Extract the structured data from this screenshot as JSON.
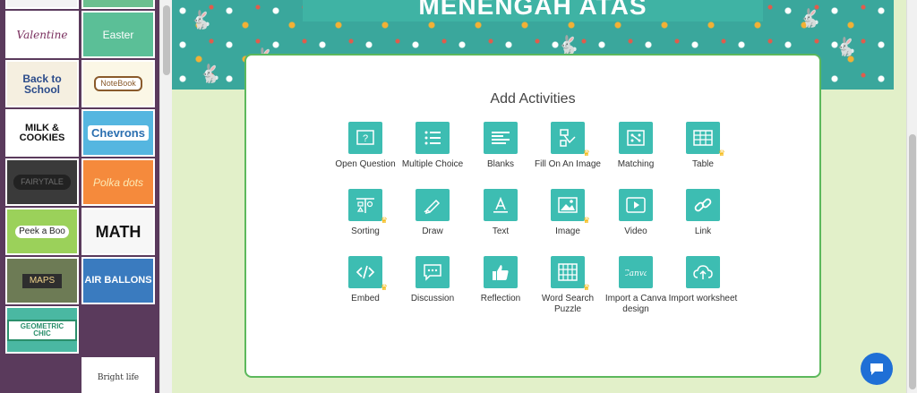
{
  "sidebar": {
    "themes": [
      {
        "label": "Valentine",
        "bg": "#ffffff",
        "color": "#7a2f5e"
      },
      {
        "label": "Easter",
        "bg": "#5bbf97",
        "color": "#ffffff"
      },
      {
        "label": "Back to School",
        "bg": "#f5efe0",
        "color": "#2b4b8a"
      },
      {
        "label": "NoteBook",
        "bg": "#fbf7e6",
        "color": "#8a5a2b"
      },
      {
        "label": "MILK & COOKIES",
        "bg": "#ffffff",
        "color": "#111111"
      },
      {
        "label": "Chevrons",
        "bg": "#55b6e0",
        "color": "#2a6fb0"
      },
      {
        "label": "FAIRYTALE",
        "bg": "#3a3a3a",
        "color": "#6f6f6f"
      },
      {
        "label": "Polka dots",
        "bg": "#f58a3c",
        "color": "#fce9b4"
      },
      {
        "label": "Peek a Boo",
        "bg": "#9bd15a",
        "color": "#222222"
      },
      {
        "label": "MATH",
        "bg": "#f7f7f7",
        "color": "#111111"
      },
      {
        "label": "MAPS",
        "bg": "#6d7b55",
        "color": "#f2d48b"
      },
      {
        "label": "AIR BALLONS",
        "bg": "#3a7bbf",
        "color": "#ffffff"
      },
      {
        "label": "GEOMETRIC CHIC",
        "bg": "#4ab8a2",
        "color": "#2a8f6b"
      },
      {
        "label": "Bright life",
        "bg": "#ffffff",
        "color": "#333333"
      }
    ]
  },
  "banner": {
    "title": "MENENGAH ATAS"
  },
  "card": {
    "title": "Add Activities",
    "activities": [
      {
        "label": "Open Question",
        "icon": "question-icon",
        "premium": false
      },
      {
        "label": "Multiple Choice",
        "icon": "list-icon",
        "premium": false
      },
      {
        "label": "Blanks",
        "icon": "blanks-icon",
        "premium": false
      },
      {
        "label": "Fill On An Image",
        "icon": "fill-image-icon",
        "premium": true
      },
      {
        "label": "Matching",
        "icon": "matching-icon",
        "premium": false
      },
      {
        "label": "Table",
        "icon": "table-icon",
        "premium": true
      },
      {
        "label": "Sorting",
        "icon": "sorting-icon",
        "premium": true
      },
      {
        "label": "Draw",
        "icon": "draw-icon",
        "premium": false
      },
      {
        "label": "Text",
        "icon": "text-icon",
        "premium": false
      },
      {
        "label": "Image",
        "icon": "image-icon",
        "premium": true
      },
      {
        "label": "Video",
        "icon": "video-icon",
        "premium": false
      },
      {
        "label": "Link",
        "icon": "link-icon",
        "premium": false
      },
      {
        "label": "Embed",
        "icon": "embed-icon",
        "premium": true
      },
      {
        "label": "Discussion",
        "icon": "discussion-icon",
        "premium": false
      },
      {
        "label": "Reflection",
        "icon": "thumbs-up-icon",
        "premium": false
      },
      {
        "label": "Word Search Puzzle",
        "icon": "grid-icon",
        "premium": true
      },
      {
        "label": "Import a Canva design",
        "icon": "canva-icon",
        "premium": false
      },
      {
        "label": "Import worksheet",
        "icon": "upload-cloud-icon",
        "premium": false
      }
    ]
  },
  "chat": {
    "icon": "chat-icon"
  }
}
